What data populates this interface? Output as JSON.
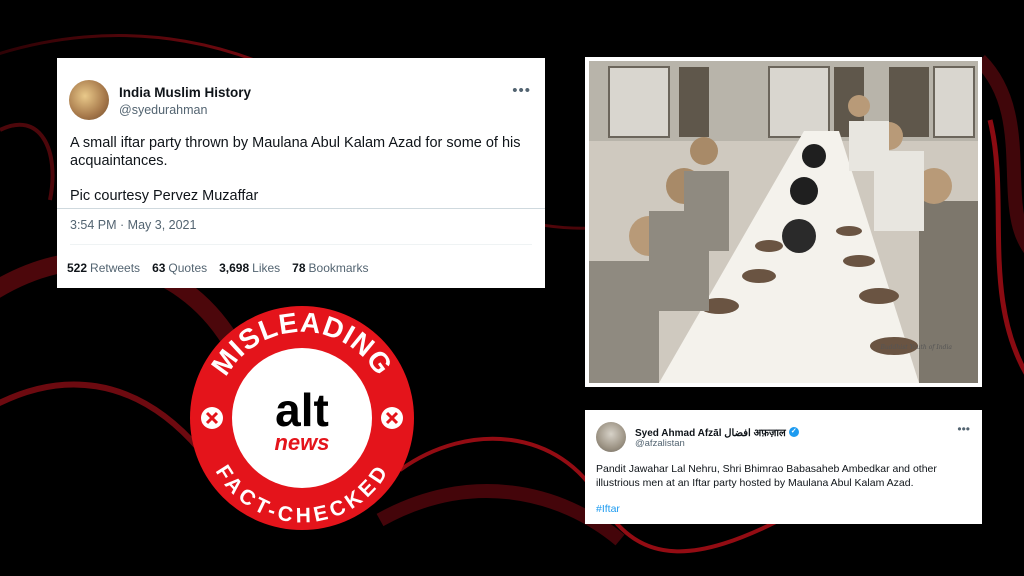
{
  "tweet1": {
    "display_name": "India Muslim History",
    "handle": "@syedurahman",
    "more_icon": "more-horizontal-icon",
    "text_line1": "A small iftar party thrown by Maulana Abul Kalam Azad for some of his acquaintances.",
    "text_line2": "Pic courtesy Pervez Muzaffar",
    "timestamp": "3:54 PM · May 3, 2021",
    "stats": {
      "retweets_count": "522",
      "retweets_label": "Retweets",
      "quotes_count": "63",
      "quotes_label": "Quotes",
      "likes_count": "3,698",
      "likes_label": "Likes",
      "bookmarks_count": "78",
      "bookmarks_label": "Bookmarks"
    }
  },
  "photo": {
    "credit": "Buddhist Youth of India"
  },
  "tweet2": {
    "display_name": "Syed Ahmad Afzāl افضال अफ़ज़ाल",
    "handle": "@afzalistan",
    "verified_icon": "verified-badge-icon",
    "text": "Pandit Jawahar Lal Nehru, Shri Bhimrao Babasaheb Ambedkar and other illustrious men at an Iftar party hosted by Maulana Abul Kalam Azad.",
    "hashtag": "#Iftar"
  },
  "badge": {
    "top_text": "MISLEADING",
    "logo_top": "alt",
    "logo_bottom": "news",
    "bottom_text": "FACT-CHECKED",
    "colors": {
      "red": "#e4141b",
      "white": "#ffffff",
      "black": "#000000"
    }
  },
  "colors": {
    "background": "#000000",
    "accent_swirl": "#c4101a",
    "link_blue": "#1d9bf0"
  }
}
